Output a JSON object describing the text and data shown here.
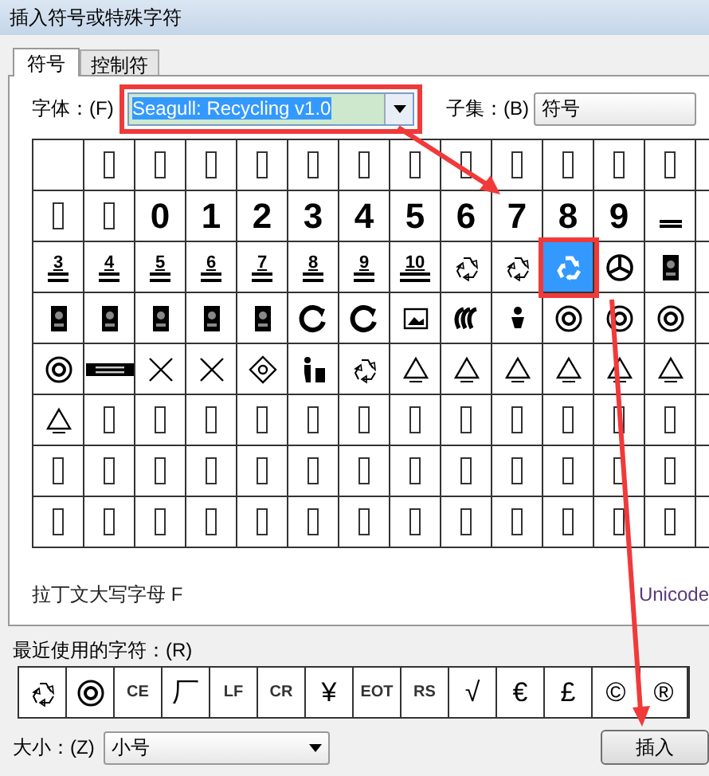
{
  "window": {
    "title": "插入符号或特殊字符"
  },
  "tabs": [
    {
      "label": "符号",
      "selected": true
    },
    {
      "label": "控制符",
      "selected": false
    }
  ],
  "font_field": {
    "label": "字体：(F)",
    "value": "Seagull: Recycling v1.0",
    "highlighted": true
  },
  "subset_field": {
    "label": "子集：(B)",
    "value": "符号"
  },
  "grid": {
    "rows": [
      [
        {
          "kind": "empty",
          "selected": false
        },
        {
          "kind": "tofu",
          "selected": false
        },
        {
          "kind": "tofu",
          "selected": false
        },
        {
          "kind": "tofu",
          "selected": false
        },
        {
          "kind": "tofu",
          "selected": false
        },
        {
          "kind": "tofu",
          "selected": false
        },
        {
          "kind": "tofu",
          "selected": false
        },
        {
          "kind": "tofu",
          "selected": false
        },
        {
          "kind": "tofu",
          "selected": false
        },
        {
          "kind": "tofu",
          "selected": false
        },
        {
          "kind": "tofu",
          "selected": false
        },
        {
          "kind": "tofu",
          "selected": false
        },
        {
          "kind": "tofu",
          "selected": false
        }
      ],
      [
        {
          "kind": "tofu",
          "selected": false
        },
        {
          "kind": "tofu",
          "selected": false
        },
        {
          "kind": "digit",
          "text": "0",
          "selected": false
        },
        {
          "kind": "digit",
          "text": "1",
          "selected": false
        },
        {
          "kind": "digit",
          "text": "2",
          "selected": false
        },
        {
          "kind": "digit",
          "text": "3",
          "selected": false
        },
        {
          "kind": "digit",
          "text": "4",
          "selected": false
        },
        {
          "kind": "digit",
          "text": "5",
          "selected": false
        },
        {
          "kind": "digit",
          "text": "6",
          "selected": false
        },
        {
          "kind": "digit",
          "text": "7",
          "selected": false
        },
        {
          "kind": "digit",
          "text": "8",
          "selected": false
        },
        {
          "kind": "digit",
          "text": "9",
          "selected": false
        },
        {
          "kind": "bar",
          "selected": false
        }
      ],
      [
        {
          "kind": "bin-level",
          "text": "3",
          "selected": false
        },
        {
          "kind": "bin-level",
          "text": "4",
          "selected": false
        },
        {
          "kind": "bin-level",
          "text": "5",
          "selected": false
        },
        {
          "kind": "bin-level",
          "text": "6",
          "selected": false
        },
        {
          "kind": "bin-level",
          "text": "7",
          "selected": false
        },
        {
          "kind": "bin-level",
          "text": "8",
          "selected": false
        },
        {
          "kind": "bin-level",
          "text": "9",
          "selected": false
        },
        {
          "kind": "bin-level",
          "text": "10",
          "selected": false
        },
        {
          "kind": "recycle-outline",
          "selected": false
        },
        {
          "kind": "recycle-outline",
          "selected": false
        },
        {
          "kind": "recycle",
          "selected": true,
          "highlighted": true
        },
        {
          "kind": "fan",
          "selected": false
        },
        {
          "kind": "tag",
          "selected": false
        }
      ],
      [
        {
          "kind": "tag",
          "selected": false
        },
        {
          "kind": "tag",
          "selected": false
        },
        {
          "kind": "tag",
          "selected": false
        },
        {
          "kind": "tag",
          "selected": false
        },
        {
          "kind": "tag",
          "selected": false
        },
        {
          "kind": "circle-arrow",
          "selected": false
        },
        {
          "kind": "circle-arrow",
          "selected": false
        },
        {
          "kind": "frame",
          "selected": false
        },
        {
          "kind": "waves",
          "selected": false
        },
        {
          "kind": "figure",
          "selected": false
        },
        {
          "kind": "badge",
          "selected": false
        },
        {
          "kind": "badge",
          "selected": false
        },
        {
          "kind": "badge",
          "selected": false
        }
      ],
      [
        {
          "kind": "badge",
          "selected": false
        },
        {
          "kind": "label",
          "selected": false
        },
        {
          "kind": "cross",
          "selected": false
        },
        {
          "kind": "cross",
          "selected": false
        },
        {
          "kind": "diamond",
          "selected": false
        },
        {
          "kind": "person-bin",
          "selected": false
        },
        {
          "kind": "recycle-outline",
          "selected": false
        },
        {
          "kind": "resin",
          "selected": false
        },
        {
          "kind": "resin",
          "selected": false
        },
        {
          "kind": "resin",
          "selected": false
        },
        {
          "kind": "resin",
          "selected": false
        },
        {
          "kind": "resin",
          "selected": false
        },
        {
          "kind": "resin",
          "selected": false
        }
      ],
      [
        {
          "kind": "resin",
          "selected": false
        },
        {
          "kind": "tofu",
          "selected": false
        },
        {
          "kind": "tofu",
          "selected": false
        },
        {
          "kind": "tofu",
          "selected": false
        },
        {
          "kind": "tofu",
          "selected": false
        },
        {
          "kind": "tofu",
          "selected": false
        },
        {
          "kind": "tofu",
          "selected": false
        },
        {
          "kind": "tofu",
          "selected": false
        },
        {
          "kind": "tofu",
          "selected": false
        },
        {
          "kind": "tofu",
          "selected": false
        },
        {
          "kind": "tofu",
          "selected": false
        },
        {
          "kind": "tofu",
          "selected": false
        },
        {
          "kind": "tofu",
          "selected": false
        }
      ],
      [
        {
          "kind": "tofu",
          "selected": false
        },
        {
          "kind": "tofu",
          "selected": false
        },
        {
          "kind": "tofu",
          "selected": false
        },
        {
          "kind": "tofu",
          "selected": false
        },
        {
          "kind": "tofu",
          "selected": false
        },
        {
          "kind": "tofu",
          "selected": false
        },
        {
          "kind": "tofu",
          "selected": false
        },
        {
          "kind": "tofu",
          "selected": false
        },
        {
          "kind": "tofu",
          "selected": false
        },
        {
          "kind": "tofu",
          "selected": false
        },
        {
          "kind": "tofu",
          "selected": false
        },
        {
          "kind": "tofu",
          "selected": false
        },
        {
          "kind": "tofu",
          "selected": false
        }
      ],
      [
        {
          "kind": "tofu",
          "selected": false
        },
        {
          "kind": "tofu",
          "selected": false
        },
        {
          "kind": "tofu",
          "selected": false
        },
        {
          "kind": "tofu",
          "selected": false
        },
        {
          "kind": "tofu",
          "selected": false
        },
        {
          "kind": "tofu",
          "selected": false
        },
        {
          "kind": "tofu",
          "selected": false
        },
        {
          "kind": "tofu",
          "selected": false
        },
        {
          "kind": "tofu",
          "selected": false
        },
        {
          "kind": "tofu",
          "selected": false
        },
        {
          "kind": "tofu",
          "selected": false
        },
        {
          "kind": "tofu",
          "selected": false
        },
        {
          "kind": "tofu",
          "selected": false
        }
      ]
    ]
  },
  "char_name": "拉丁文大写字母 F",
  "code_label": "Unicode",
  "recent": {
    "label": "最近使用的字符：(R)",
    "items": [
      {
        "kind": "recycle-outline"
      },
      {
        "kind": "badge"
      },
      {
        "kind": "text",
        "text": "CE"
      },
      {
        "kind": "text",
        "text": "厂"
      },
      {
        "kind": "text",
        "text": "LF"
      },
      {
        "kind": "text",
        "text": "CR"
      },
      {
        "kind": "text",
        "text": "¥"
      },
      {
        "kind": "text",
        "text": "EOT"
      },
      {
        "kind": "text",
        "text": "RS"
      },
      {
        "kind": "text",
        "text": "√"
      },
      {
        "kind": "text",
        "text": "€"
      },
      {
        "kind": "text",
        "text": "£"
      },
      {
        "kind": "text",
        "text": "©"
      },
      {
        "kind": "text",
        "text": "®"
      }
    ]
  },
  "size_field": {
    "label": "大小：(Z)",
    "value": "小号"
  },
  "insert_button": {
    "label": "插入"
  },
  "annotations": {
    "arrow_to_grid": true,
    "arrow_to_insert": true
  }
}
